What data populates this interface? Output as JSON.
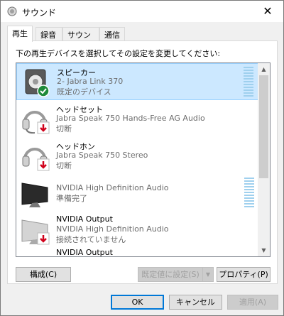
{
  "window": {
    "title": "サウンド",
    "close_glyph": "✕"
  },
  "tabs": [
    {
      "label": "再生"
    },
    {
      "label": "録音"
    },
    {
      "label": "サウンド"
    },
    {
      "label": "通信"
    }
  ],
  "instruction": "下の再生デバイスを選択してその設定を変更してください:",
  "devices": [
    {
      "name": "スピーカー",
      "detail": "2- Jabra Link 370",
      "status": "既定のデバイス",
      "icon": "speaker-icon",
      "badge": "default-check-icon"
    },
    {
      "name": "ヘッドセット",
      "detail": "Jabra Speak 750 Hands-Free AG Audio",
      "status": "切断",
      "icon": "headset-icon",
      "badge": "disconnected-arrow-icon"
    },
    {
      "name": "ヘッドホン",
      "detail": "Jabra Speak 750 Stereo",
      "status": "切断",
      "icon": "headphones-icon",
      "badge": "disconnected-arrow-icon"
    },
    {
      "name": "",
      "detail": "NVIDIA High Definition Audio",
      "status": "準備完了",
      "icon": "monitor-icon",
      "badge": ""
    },
    {
      "name": "NVIDIA Output",
      "detail": "NVIDIA High Definition Audio",
      "status": "接続されていません",
      "icon": "monitor-icon",
      "badge": "disconnected-arrow-icon"
    },
    {
      "name": "NVIDIA Output",
      "detail": "",
      "status": "",
      "icon": "monitor-icon",
      "badge": ""
    }
  ],
  "buttons": {
    "configure": "構成(C)",
    "set_default": "既定値に設定(S)",
    "properties": "プロパティ(P)",
    "ok": "OK",
    "cancel": "キャンセル",
    "apply": "適用(A)"
  },
  "colors": {
    "selection": "#cce8ff",
    "accent": "#0078d7",
    "check_green": "#1e8a3a",
    "disconnect_red": "#d0021b"
  }
}
